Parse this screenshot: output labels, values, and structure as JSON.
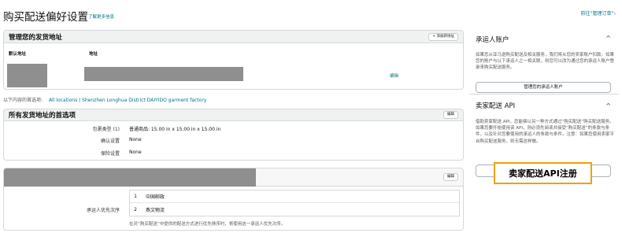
{
  "page": {
    "title": "购买配送偏好设置",
    "learn_more": "了解更多信息",
    "goto_link": "前往“管理订单”›"
  },
  "ship_from": {
    "title": "管理您的发货地址",
    "add_button": "+ 添加新地址",
    "col_default": "默认地址",
    "col_address": "地址",
    "edit_link": "编辑"
  },
  "filter": {
    "label": "以下内容的首选项:",
    "value": "All locations | Shenzhen Longhua District DAIYIDO garment factory"
  },
  "all_prefs": {
    "title": "所有发货地址的首选项",
    "edit_button": "编辑",
    "rows": [
      {
        "label": "包裹类型 (1)",
        "value": "普通商品: 15.00 in x 15.00 in x 15.00 in"
      },
      {
        "label": "确认设置",
        "value": "None"
      },
      {
        "label": "保险设置",
        "value": "None"
      }
    ]
  },
  "carrier_prefs": {
    "edit_button": "编辑",
    "label": "承运人优先次序",
    "carriers": [
      {
        "num": "1",
        "name": "中国邮政"
      },
      {
        "num": "2",
        "name": "燕文物流"
      }
    ],
    "note": "在对“购买配送”中提供的配送方式进行优先排序时，将使用这一承运人优先次序。"
  },
  "sidebar": {
    "carrier_account": {
      "title": "承运人账户",
      "chevron": "^",
      "text": "如果您从亚马逊购买配送及相关服务，我们将从您的卖家账户扣款。如果您的账户与以下承运人之一相关联，则您可以改为通过您的承运人账户登录来购买配送服务。",
      "button": "管理您的承运人账户"
    },
    "seller_api": {
      "title": "卖家配送 API",
      "chevron": "^",
      "text": "借助卖家配送 API，您能够以另一种方式通过“购买配送”购买配送服务。如果您要开始使用该 API，则必须先阅读并接受“购买配送”的条款与条件，以及针对您要使用的承运人的条款与条件。注意：如果您使用卖家平台购买配送服务，则无需这样做。",
      "highlight": "卖家配送API注册"
    }
  }
}
